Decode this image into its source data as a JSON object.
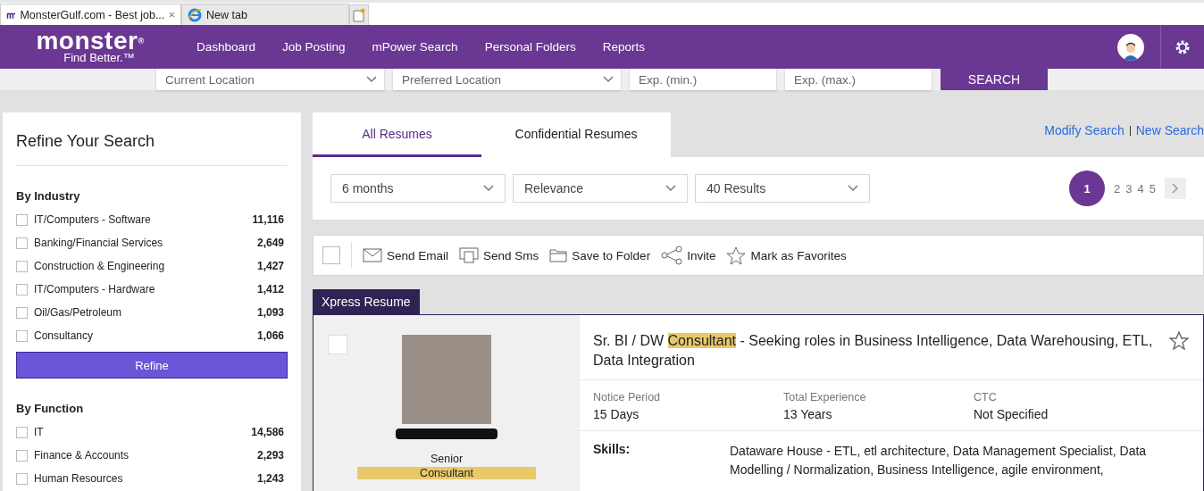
{
  "browser_tabs": [
    {
      "title": "MonsterGulf.com - Best job...",
      "kind": "site",
      "selected": true
    },
    {
      "title": "New tab",
      "kind": "ie",
      "selected": false
    }
  ],
  "header": {
    "logo": "monster",
    "logo_mark": "®",
    "tagline": "Find Better.™",
    "nav": [
      "Dashboard",
      "Job Posting",
      "mPower Search",
      "Personal Folders",
      "Reports"
    ]
  },
  "search_bar": {
    "fields": [
      {
        "kind": "select",
        "placeholder": "Current Location"
      },
      {
        "kind": "select",
        "placeholder": "Preferred Location"
      },
      {
        "kind": "text",
        "placeholder": "Exp. (min.)"
      },
      {
        "kind": "text",
        "placeholder": "Exp. (max.)"
      }
    ],
    "button": "SEARCH"
  },
  "sidebar": {
    "title": "Refine Your Search",
    "sections": [
      {
        "title": "By Industry",
        "items": [
          {
            "label": "IT/Computers - Software",
            "count": "11,116",
            "checked": false
          },
          {
            "label": "Banking/Financial Services",
            "count": "2,649",
            "checked": false
          },
          {
            "label": "Construction & Engineering",
            "count": "1,427",
            "checked": false
          },
          {
            "label": "IT/Computers - Hardware",
            "count": "1,412",
            "checked": false
          },
          {
            "label": "Oil/Gas/Petroleum",
            "count": "1,093",
            "checked": false
          },
          {
            "label": "Consultancy",
            "count": "1,066",
            "checked": false
          }
        ],
        "button": "Refine"
      },
      {
        "title": "By Function",
        "items": [
          {
            "label": "IT",
            "count": "14,586",
            "checked": false
          },
          {
            "label": "Finance & Accounts",
            "count": "2,293",
            "checked": false
          },
          {
            "label": "Human Resources",
            "count": "1,243",
            "checked": false
          }
        ]
      }
    ]
  },
  "result_tabs": [
    {
      "label": "All Resumes",
      "selected": true
    },
    {
      "label": "Confidential Resumes",
      "selected": false
    }
  ],
  "links": [
    "Modify Search",
    "New Search"
  ],
  "filters": [
    "6 months",
    "Relevance",
    "40 Results"
  ],
  "pagination": [
    {
      "label": "1",
      "selected": true
    },
    {
      "label": "2",
      "selected": false
    },
    {
      "label": "3",
      "selected": false
    },
    {
      "label": "4",
      "selected": false
    },
    {
      "label": "5",
      "selected": false
    }
  ],
  "toolbar": {
    "select_all_checked": false,
    "actions": [
      {
        "kind": "email",
        "label": "Send Email"
      },
      {
        "kind": "sms",
        "label": "Send Sms"
      },
      {
        "kind": "folder",
        "label": "Save to Folder"
      },
      {
        "kind": "share",
        "label": "Invite"
      },
      {
        "kind": "star",
        "label": "Mark as Favorites"
      }
    ]
  },
  "result": {
    "badge": "Xpress Resume",
    "checked": false,
    "favorite": false,
    "designation_line1": "Senior",
    "designation_line2": "Consultant",
    "title": [
      {
        "text": "Sr. BI / DW ",
        "highlighted": false
      },
      {
        "text": "Consultant",
        "highlighted": true
      },
      {
        "text": " - Seeking roles in Business Intelligence, Data Warehousing, ETL, Data Integration",
        "highlighted": false
      }
    ],
    "facts": [
      {
        "label": "Notice Period",
        "value": "15 Days"
      },
      {
        "label": "Total Experience",
        "value": "13 Years"
      },
      {
        "label": "CTC",
        "value": "Not Specified"
      }
    ],
    "skills_label": "Skills:",
    "skills": "Dataware House - ETL, etl architecture, Data Management Specialist, Data Modelling / Normalization, Business Intelligence, agile environment,"
  }
}
